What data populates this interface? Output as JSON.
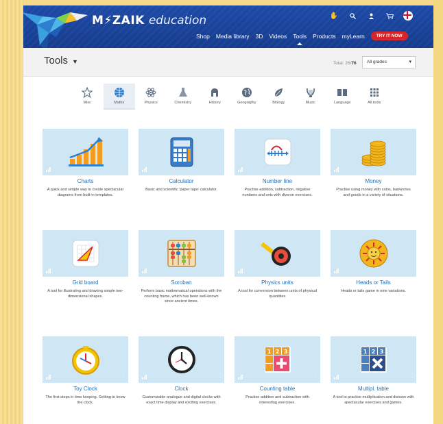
{
  "brand": {
    "logo_word": "M⚡ZAIK",
    "logo_sub": "education"
  },
  "nav": [
    "Shop",
    "Media library",
    "3D",
    "Videos",
    "Tools",
    "Products",
    "myLearn"
  ],
  "nav_active": "Tools",
  "try_label": "TRY IT NOW",
  "top_icons": [
    "hands-icon",
    "search-icon",
    "user-icon",
    "cart-icon",
    "uk-flag-icon"
  ],
  "toolbar": {
    "title": "Tools",
    "total_label": "Total:",
    "total_current": "26",
    "total_sep": "/",
    "total_all": "76",
    "grade_value": "All grades"
  },
  "categories": [
    {
      "label": "Misc",
      "icon": "star-icon"
    },
    {
      "label": "Maths",
      "icon": "globe-icon",
      "active": true
    },
    {
      "label": "Physics",
      "icon": "atom-icon"
    },
    {
      "label": "Chemistry",
      "icon": "flask-icon"
    },
    {
      "label": "History",
      "icon": "helmet-icon"
    },
    {
      "label": "Geography",
      "icon": "earth-icon"
    },
    {
      "label": "Biology",
      "icon": "leaf-icon"
    },
    {
      "label": "Music",
      "icon": "lyre-icon"
    },
    {
      "label": "Language",
      "icon": "book-icon"
    },
    {
      "label": "All tools",
      "icon": "grid-icon"
    }
  ],
  "tools": [
    {
      "title": "Charts",
      "desc": "A quick and simple way to create spectacular diagrams from built-in templates.",
      "icon": "bar-chart-icon"
    },
    {
      "title": "Calculator",
      "desc": "Basic and scientific 'paper tape' calculator.",
      "icon": "calculator-icon"
    },
    {
      "title": "Number line",
      "desc": "Practise addition, subtraction, negative numbers and sets with diverse exercises.",
      "icon": "number-line-icon"
    },
    {
      "title": "Money",
      "desc": "Practise using money with coins, banknotes and goods in a variety of situations.",
      "icon": "coins-icon"
    },
    {
      "title": "Grid board",
      "desc": "A tool for illustrating and drawing simple two-dimensional shapes.",
      "icon": "grid-board-icon"
    },
    {
      "title": "Soroban",
      "desc": "Perform basic mathematical operations with the counting frame, which has been well-known since ancient times.",
      "icon": "abacus-icon"
    },
    {
      "title": "Physics units",
      "desc": "A tool for conversion between units of physical quantities",
      "icon": "tape-measure-icon"
    },
    {
      "title": "Heads or Tails",
      "desc": "Heads or tails game in nine variations.",
      "icon": "sun-coin-icon"
    },
    {
      "title": "Toy Clock",
      "desc": "The first steps in time keeping. Getting to know the clock.",
      "icon": "toy-clock-icon"
    },
    {
      "title": "Clock",
      "desc": "Customizable analogue and digital clocks with exact time display and exciting exercises.",
      "icon": "clock-icon"
    },
    {
      "title": "Counting table",
      "desc": "Practise addition and subtraction with interesting exercises.",
      "icon": "counting-table-icon"
    },
    {
      "title": "Multipl. table",
      "desc": "A tool to practise multiplication and division with spectacular exercises and games.",
      "icon": "multiplication-table-icon"
    }
  ],
  "counting_digits": [
    "1",
    "2",
    "3"
  ],
  "colors": {
    "header": "#1d4aa8",
    "accent_link": "#1e6fb8",
    "try_button": "#d7262b",
    "thumb_bg": "#cfe6f5",
    "page_bg": "#f6d98a"
  }
}
